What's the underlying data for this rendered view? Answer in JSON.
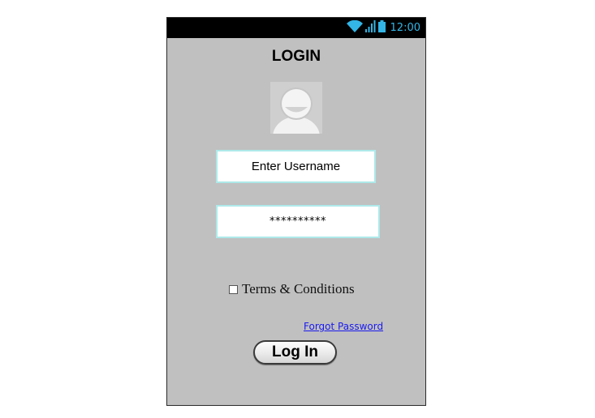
{
  "status_bar": {
    "time": "12:00",
    "icons": [
      "wifi-icon",
      "signal-icon",
      "battery-icon"
    ],
    "icon_color": "#33b5e5"
  },
  "screen": {
    "title": "LOGIN",
    "avatar_icon": "user-avatar-icon",
    "username_field": {
      "placeholder": "Enter Username"
    },
    "password_field": {
      "value": "**********"
    },
    "terms_label": "Terms & Conditions",
    "terms_checked": false,
    "forgot_password_link": "Forgot Password",
    "login_button": "Log In"
  },
  "colors": {
    "screen_background": "#c0c0c0",
    "status_bar_background": "#000000",
    "field_border": "#aee9ea",
    "link": "#1a1aee"
  }
}
